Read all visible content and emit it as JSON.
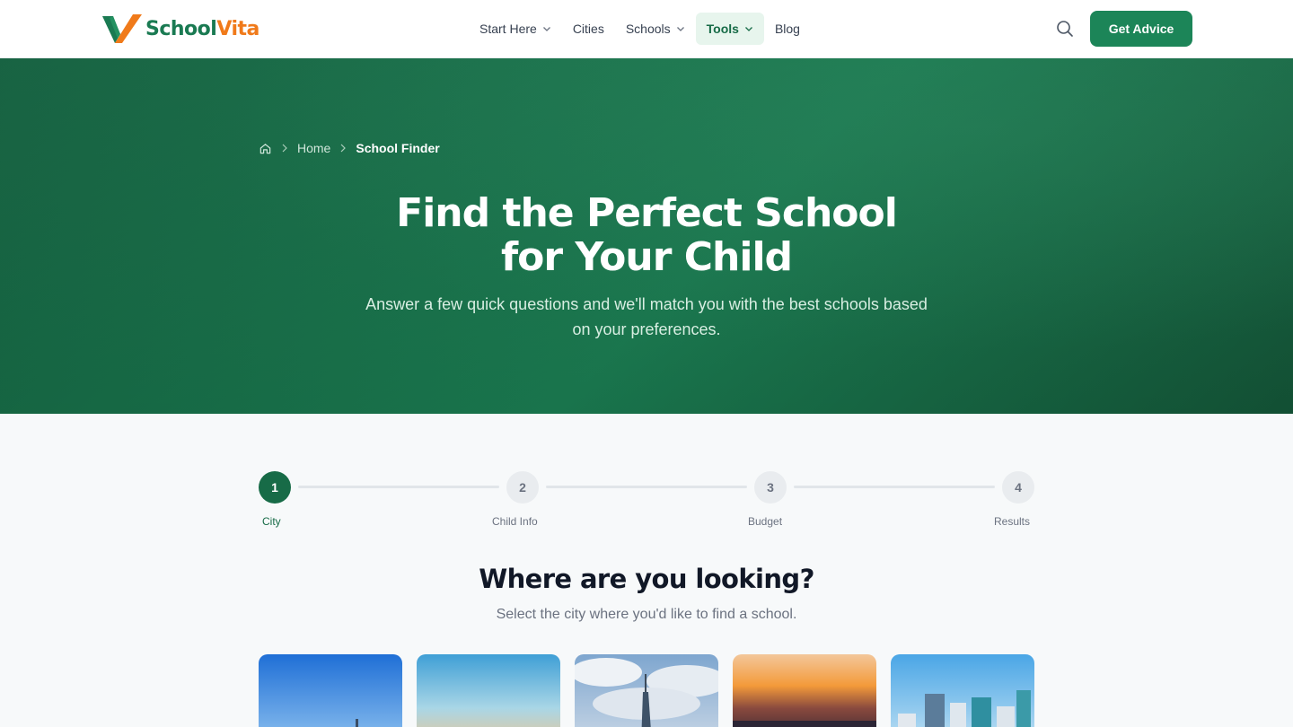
{
  "brand": {
    "name_part1": "School",
    "name_part2": "Vita",
    "green": "#1a7a52",
    "orange": "#f07a1a"
  },
  "nav": {
    "items": [
      {
        "label": "Start Here",
        "has_dropdown": true
      },
      {
        "label": "Cities",
        "has_dropdown": false
      },
      {
        "label": "Schools",
        "has_dropdown": true
      },
      {
        "label": "Tools",
        "has_dropdown": true,
        "active": true
      },
      {
        "label": "Blog",
        "has_dropdown": false
      }
    ],
    "search_icon": "search-icon",
    "cta_label": "Get Advice"
  },
  "hero": {
    "breadcrumb": {
      "home_icon": "home-icon",
      "home": "Home",
      "current": "School Finder"
    },
    "title_line1": "Find the Perfect School",
    "title_line2": "for Your Child",
    "subtitle": "Answer a few quick questions and we'll match you with the best schools based on your preferences."
  },
  "stepper": {
    "current_step": 1,
    "steps": [
      {
        "number": "1",
        "label": "City"
      },
      {
        "number": "2",
        "label": "Child Info"
      },
      {
        "number": "3",
        "label": "Budget"
      },
      {
        "number": "4",
        "label": "Results"
      }
    ]
  },
  "question": {
    "title": "Where are you looking?",
    "subtitle": "Select the city where you'd like to find a school."
  },
  "colors": {
    "accent": "#1c8558",
    "hero_bg": "#176b47",
    "active_step": "#176b47"
  }
}
